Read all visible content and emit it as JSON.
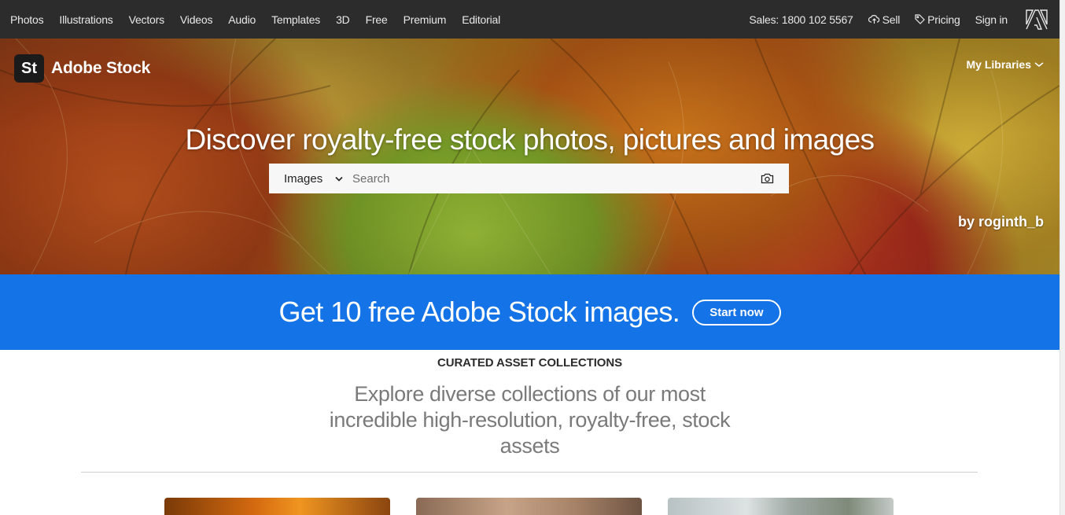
{
  "topnav": {
    "links": [
      "Photos",
      "Illustrations",
      "Vectors",
      "Videos",
      "Audio",
      "Templates",
      "3D",
      "Free",
      "Premium",
      "Editorial"
    ],
    "sales": "Sales: 1800 102 5567",
    "sell": "Sell",
    "pricing": "Pricing",
    "signin": "Sign in"
  },
  "hero": {
    "brand_badge": "St",
    "brand_name": "Adobe Stock",
    "my_libraries": "My Libraries",
    "title": "Discover royalty-free stock photos, pictures and images",
    "search": {
      "category": "Images",
      "placeholder": "Search"
    },
    "credit": "by roginth_b"
  },
  "promo": {
    "text": "Get 10 free Adobe Stock images.",
    "button": "Start now",
    "color": "#1473e6"
  },
  "collections": {
    "heading": "CURATED ASSET COLLECTIONS",
    "subheading": "Explore diverse collections of our most incredible high-resolution, royalty-free, stock assets"
  },
  "icons": {
    "sell": "upload-cloud-icon",
    "pricing": "tag-icon",
    "adobe": "adobe-logo-icon",
    "search_camera": "camera-icon",
    "dropdown": "chevron-down-icon"
  }
}
